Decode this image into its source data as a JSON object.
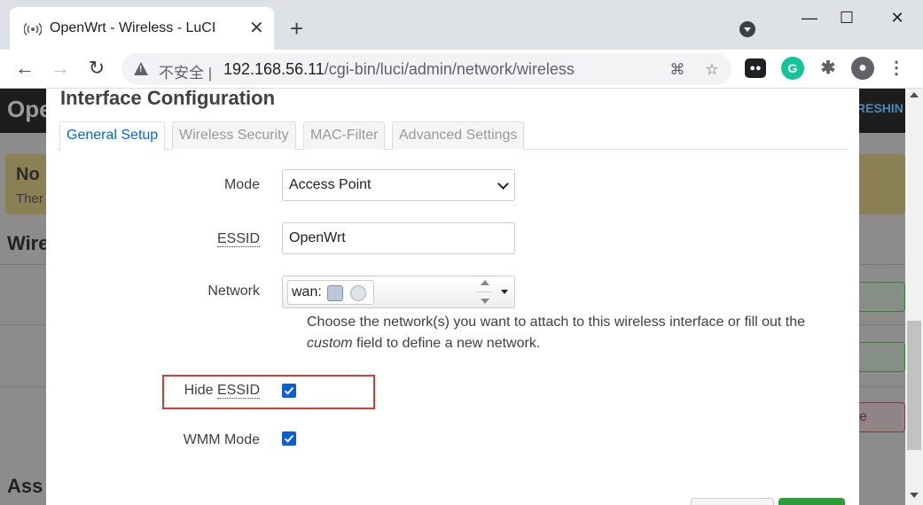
{
  "browser": {
    "tab_title": "OpenWrt - Wireless - LuCI",
    "tab_close": "✕",
    "new_tab": "+",
    "minimize": "—",
    "maximize": "☐",
    "close": "✕",
    "back": "←",
    "forward": "→",
    "reload": "↻",
    "security_label": "不安全 |",
    "url_host": "192.168.56.11",
    "url_path": "/cgi-bin/luci/admin/network/wireless",
    "translate_icon": "⌘",
    "bookmark_icon": "☆",
    "grammarly_label": "G",
    "extensions_icon": "✱",
    "menu_icon": "⋮"
  },
  "background": {
    "logo": "Ope",
    "refresh": "RESHIN",
    "alert_title": "No",
    "alert_text": "Ther",
    "section_title": "Wire",
    "section_title2": "Ass",
    "button_text": "e"
  },
  "modal": {
    "title": "Interface Configuration",
    "tabs": [
      "General Setup",
      "Wireless Security",
      "MAC-Filter",
      "Advanced Settings"
    ],
    "active_tab": "General Setup",
    "fields": {
      "mode_label": "Mode",
      "mode_value": "Access Point",
      "essid_label": "ESSID",
      "essid_value": "OpenWrt",
      "network_label": "Network",
      "network_value": "wan:",
      "network_help_1": "Choose the network(s) you want to attach to this wireless interface or fill out the",
      "network_help_em": "custom",
      "network_help_2": " field to define a new network.",
      "hide_essid_label_prefix": "Hide ",
      "hide_essid_label_abbr": "ESSID",
      "hide_essid_checked": true,
      "wmm_label": "WMM Mode",
      "wmm_checked": true
    }
  },
  "colors": {
    "accent": "#0069d6",
    "checkbox": "#0b5ed7",
    "highlight": "#d83a3a"
  }
}
